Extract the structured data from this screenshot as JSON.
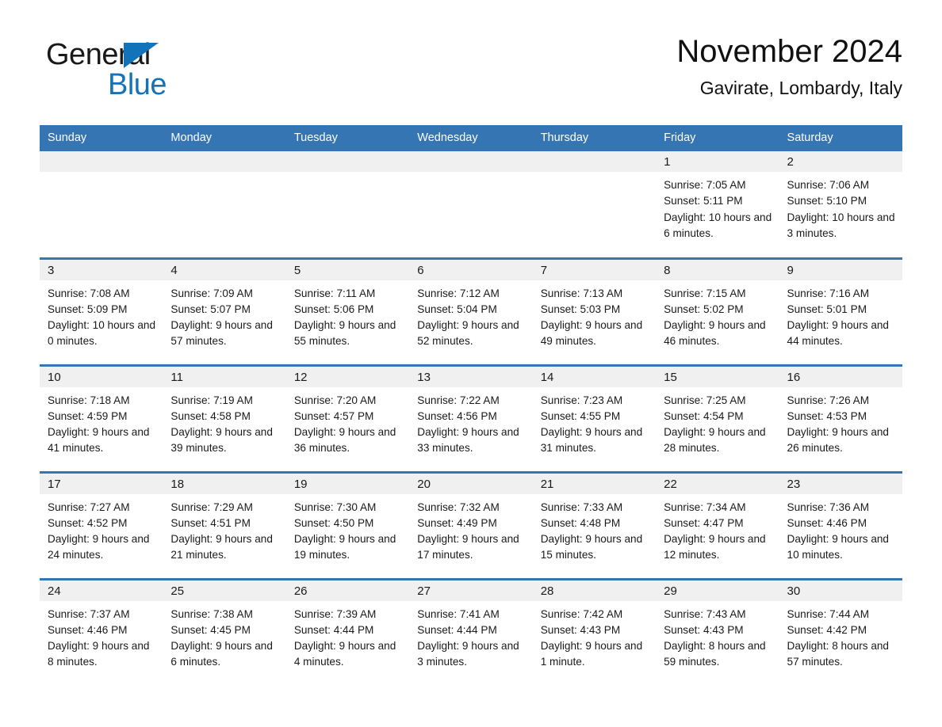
{
  "brand": {
    "name_part1": "General",
    "name_part2": "Blue",
    "triangle_color": "#1373b8"
  },
  "header": {
    "title": "November 2024",
    "subtitle": "Gavirate, Lombardy, Italy"
  },
  "theme": {
    "header_blue": "#3575b4",
    "daynum_band": "#f0f0f0",
    "text": "#1a1a1a",
    "page_background": "#ffffff"
  },
  "calendar": {
    "weekday_headers": [
      "Sunday",
      "Monday",
      "Tuesday",
      "Wednesday",
      "Thursday",
      "Friday",
      "Saturday"
    ],
    "weeks": [
      [
        {
          "day": "",
          "sunrise": "",
          "sunset": "",
          "daylight": ""
        },
        {
          "day": "",
          "sunrise": "",
          "sunset": "",
          "daylight": ""
        },
        {
          "day": "",
          "sunrise": "",
          "sunset": "",
          "daylight": ""
        },
        {
          "day": "",
          "sunrise": "",
          "sunset": "",
          "daylight": ""
        },
        {
          "day": "",
          "sunrise": "",
          "sunset": "",
          "daylight": ""
        },
        {
          "day": "1",
          "sunrise": "Sunrise: 7:05 AM",
          "sunset": "Sunset: 5:11 PM",
          "daylight": "Daylight: 10 hours and 6 minutes."
        },
        {
          "day": "2",
          "sunrise": "Sunrise: 7:06 AM",
          "sunset": "Sunset: 5:10 PM",
          "daylight": "Daylight: 10 hours and 3 minutes."
        }
      ],
      [
        {
          "day": "3",
          "sunrise": "Sunrise: 7:08 AM",
          "sunset": "Sunset: 5:09 PM",
          "daylight": "Daylight: 10 hours and 0 minutes."
        },
        {
          "day": "4",
          "sunrise": "Sunrise: 7:09 AM",
          "sunset": "Sunset: 5:07 PM",
          "daylight": "Daylight: 9 hours and 57 minutes."
        },
        {
          "day": "5",
          "sunrise": "Sunrise: 7:11 AM",
          "sunset": "Sunset: 5:06 PM",
          "daylight": "Daylight: 9 hours and 55 minutes."
        },
        {
          "day": "6",
          "sunrise": "Sunrise: 7:12 AM",
          "sunset": "Sunset: 5:04 PM",
          "daylight": "Daylight: 9 hours and 52 minutes."
        },
        {
          "day": "7",
          "sunrise": "Sunrise: 7:13 AM",
          "sunset": "Sunset: 5:03 PM",
          "daylight": "Daylight: 9 hours and 49 minutes."
        },
        {
          "day": "8",
          "sunrise": "Sunrise: 7:15 AM",
          "sunset": "Sunset: 5:02 PM",
          "daylight": "Daylight: 9 hours and 46 minutes."
        },
        {
          "day": "9",
          "sunrise": "Sunrise: 7:16 AM",
          "sunset": "Sunset: 5:01 PM",
          "daylight": "Daylight: 9 hours and 44 minutes."
        }
      ],
      [
        {
          "day": "10",
          "sunrise": "Sunrise: 7:18 AM",
          "sunset": "Sunset: 4:59 PM",
          "daylight": "Daylight: 9 hours and 41 minutes."
        },
        {
          "day": "11",
          "sunrise": "Sunrise: 7:19 AM",
          "sunset": "Sunset: 4:58 PM",
          "daylight": "Daylight: 9 hours and 39 minutes."
        },
        {
          "day": "12",
          "sunrise": "Sunrise: 7:20 AM",
          "sunset": "Sunset: 4:57 PM",
          "daylight": "Daylight: 9 hours and 36 minutes."
        },
        {
          "day": "13",
          "sunrise": "Sunrise: 7:22 AM",
          "sunset": "Sunset: 4:56 PM",
          "daylight": "Daylight: 9 hours and 33 minutes."
        },
        {
          "day": "14",
          "sunrise": "Sunrise: 7:23 AM",
          "sunset": "Sunset: 4:55 PM",
          "daylight": "Daylight: 9 hours and 31 minutes."
        },
        {
          "day": "15",
          "sunrise": "Sunrise: 7:25 AM",
          "sunset": "Sunset: 4:54 PM",
          "daylight": "Daylight: 9 hours and 28 minutes."
        },
        {
          "day": "16",
          "sunrise": "Sunrise: 7:26 AM",
          "sunset": "Sunset: 4:53 PM",
          "daylight": "Daylight: 9 hours and 26 minutes."
        }
      ],
      [
        {
          "day": "17",
          "sunrise": "Sunrise: 7:27 AM",
          "sunset": "Sunset: 4:52 PM",
          "daylight": "Daylight: 9 hours and 24 minutes."
        },
        {
          "day": "18",
          "sunrise": "Sunrise: 7:29 AM",
          "sunset": "Sunset: 4:51 PM",
          "daylight": "Daylight: 9 hours and 21 minutes."
        },
        {
          "day": "19",
          "sunrise": "Sunrise: 7:30 AM",
          "sunset": "Sunset: 4:50 PM",
          "daylight": "Daylight: 9 hours and 19 minutes."
        },
        {
          "day": "20",
          "sunrise": "Sunrise: 7:32 AM",
          "sunset": "Sunset: 4:49 PM",
          "daylight": "Daylight: 9 hours and 17 minutes."
        },
        {
          "day": "21",
          "sunrise": "Sunrise: 7:33 AM",
          "sunset": "Sunset: 4:48 PM",
          "daylight": "Daylight: 9 hours and 15 minutes."
        },
        {
          "day": "22",
          "sunrise": "Sunrise: 7:34 AM",
          "sunset": "Sunset: 4:47 PM",
          "daylight": "Daylight: 9 hours and 12 minutes."
        },
        {
          "day": "23",
          "sunrise": "Sunrise: 7:36 AM",
          "sunset": "Sunset: 4:46 PM",
          "daylight": "Daylight: 9 hours and 10 minutes."
        }
      ],
      [
        {
          "day": "24",
          "sunrise": "Sunrise: 7:37 AM",
          "sunset": "Sunset: 4:46 PM",
          "daylight": "Daylight: 9 hours and 8 minutes."
        },
        {
          "day": "25",
          "sunrise": "Sunrise: 7:38 AM",
          "sunset": "Sunset: 4:45 PM",
          "daylight": "Daylight: 9 hours and 6 minutes."
        },
        {
          "day": "26",
          "sunrise": "Sunrise: 7:39 AM",
          "sunset": "Sunset: 4:44 PM",
          "daylight": "Daylight: 9 hours and 4 minutes."
        },
        {
          "day": "27",
          "sunrise": "Sunrise: 7:41 AM",
          "sunset": "Sunset: 4:44 PM",
          "daylight": "Daylight: 9 hours and 3 minutes."
        },
        {
          "day": "28",
          "sunrise": "Sunrise: 7:42 AM",
          "sunset": "Sunset: 4:43 PM",
          "daylight": "Daylight: 9 hours and 1 minute."
        },
        {
          "day": "29",
          "sunrise": "Sunrise: 7:43 AM",
          "sunset": "Sunset: 4:43 PM",
          "daylight": "Daylight: 8 hours and 59 minutes."
        },
        {
          "day": "30",
          "sunrise": "Sunrise: 7:44 AM",
          "sunset": "Sunset: 4:42 PM",
          "daylight": "Daylight: 8 hours and 57 minutes."
        }
      ]
    ]
  }
}
